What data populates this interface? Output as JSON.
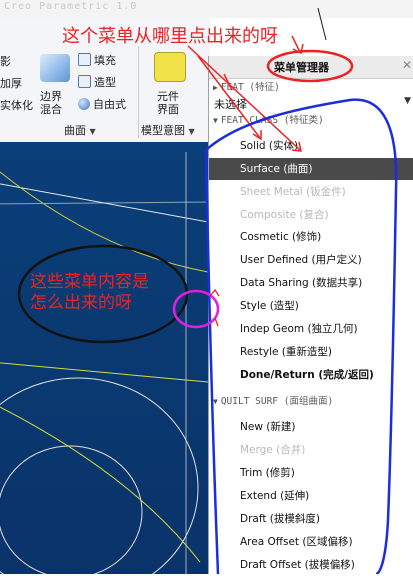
{
  "app": {
    "title": "Creo Parametric 1.0"
  },
  "ribbon": {
    "left_items": [
      "影",
      "加厚",
      "实体化"
    ],
    "blend": [
      "边界",
      "混合"
    ],
    "surface_tools": {
      "fill": "填充",
      "style": "造型",
      "freestyle": "自由式"
    },
    "element": [
      "元件",
      "界面"
    ],
    "groups": {
      "surface": "曲面",
      "model_intent": "模型意图"
    }
  },
  "panel": {
    "title": "菜单管理器",
    "feat_header": "FEAT (特征)",
    "dropdown_value": "未选择",
    "featclass_header": "FEAT CLASS (特征类)",
    "quilt_header": "QUILT SURF (面组曲面)",
    "items": [
      {
        "label": "Solid (实体)"
      },
      {
        "label": "Surface (曲面)"
      },
      {
        "label": "Sheet Metal (钣金件)"
      },
      {
        "label": "Composite (复合)"
      },
      {
        "label": "Cosmetic (修饰)"
      },
      {
        "label": "User Defined (用户定义)"
      },
      {
        "label": "Data Sharing (数据共享)"
      },
      {
        "label": "Style (造型)"
      },
      {
        "label": "Indep Geom (独立几何)"
      },
      {
        "label": "Restyle (重新造型)"
      },
      {
        "label": "Done/Return (完成/返回)"
      }
    ],
    "quilt_items": [
      {
        "label": "New (新建)"
      },
      {
        "label": "Merge (合并)"
      },
      {
        "label": "Trim (修剪)"
      },
      {
        "label": "Extend (延伸)"
      },
      {
        "label": "Draft (拔模斜度)"
      },
      {
        "label": "Area Offset (区域偏移)"
      },
      {
        "label": "Draft Offset (拔模偏移)"
      }
    ]
  },
  "annotations": {
    "top": "这个菜单从哪里点出来的呀",
    "mid_line1": "这些菜单内容是",
    "mid_line2": "怎么出来的呀"
  },
  "colors": {
    "annotation_red": "#ee2222",
    "annotation_blue": "#1a2ee0",
    "annotation_magenta": "#e020e0",
    "selection": "#4a4a4a",
    "graphics_bg": "#0a3a72"
  }
}
